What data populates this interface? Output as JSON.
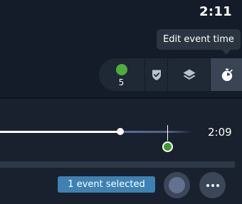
{
  "header": {
    "clock": "2:11"
  },
  "tooltip": {
    "text": "Edit event time"
  },
  "toolbar": {
    "event_count": "5",
    "event_dot_color": "#4caf3c",
    "icons": [
      "shield-check-icon",
      "layers-icon",
      "stopwatch-icon"
    ],
    "active": "stopwatch-icon"
  },
  "timeline": {
    "time_label": "2:09",
    "event_marker_color": "#3c9b2a"
  },
  "footer": {
    "selection_label": "1 event selected",
    "selection_badge_color": "#3d82b3"
  }
}
